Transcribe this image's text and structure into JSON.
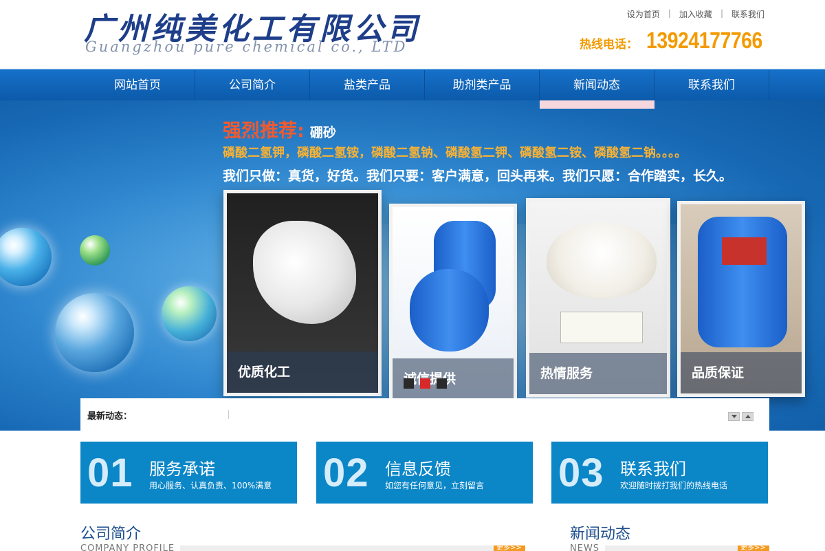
{
  "header": {
    "logo_cn": "广州纯美化工有限公司",
    "logo_en": "Guangzhou pure chemical co., LTD",
    "toplinks": [
      "设为首页",
      "加入收藏",
      "联系我们"
    ],
    "hotline_label": "热线电话：",
    "hotline_number": "13924177766"
  },
  "nav": {
    "items": [
      "网站首页",
      "公司简介",
      "盐类产品",
      "助剂类产品",
      "新闻动态",
      "联系我们"
    ]
  },
  "banner": {
    "recommend_label": "强烈推荐:",
    "recommend_value": "硼砂",
    "line2": "磷酸二氢钾，磷酸二氢铵，磷酸二氢钠、磷酸氢二钾、磷酸氢二铵、磷酸氢二钠。。。。",
    "line3": "我们只做：真货，好货。我们只要：客户满意，回头再来。我们只愿：合作踏实，长久。",
    "captions": [
      "优质化工",
      "诚信提供",
      "热情服务",
      "品质保证"
    ],
    "slider_active_index": 1
  },
  "ticker": {
    "label": "最新动态："
  },
  "services": [
    {
      "num": "01",
      "title": "服务承诺",
      "sub": "用心服务、认真负责、100%满意"
    },
    {
      "num": "02",
      "title": "信息反馈",
      "sub": "如您有任何意见，立刻留言"
    },
    {
      "num": "03",
      "title": "联系我们",
      "sub": "欢迎随时拨打我们的热线电话"
    }
  ],
  "sections": {
    "about": {
      "title": "公司简介",
      "sub": "COMPANY PROFILE",
      "more": "更多>>"
    },
    "news": {
      "title": "新闻动态",
      "sub": "NEWS",
      "more": "更多>>"
    }
  },
  "colors": {
    "nav": "#0c5aaa",
    "hotline": "#f39a00",
    "service_box": "#0b86c7",
    "heading": "#1e4e8f"
  }
}
